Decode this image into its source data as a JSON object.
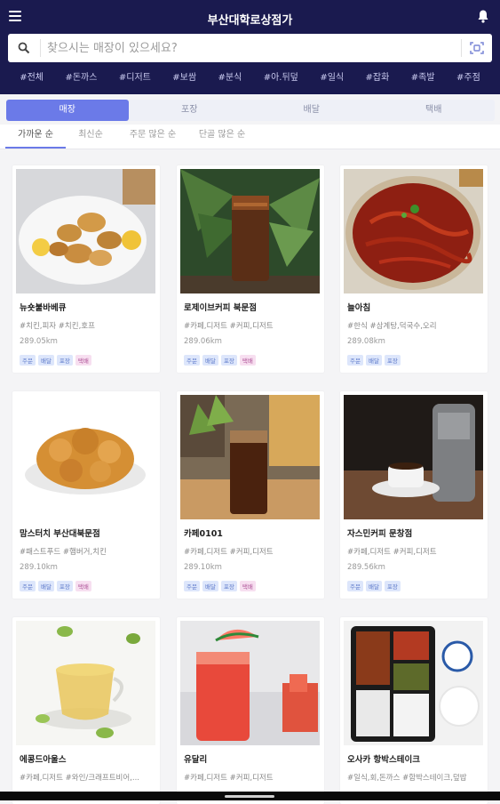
{
  "header": {
    "title": "부산대학로상점가",
    "menu_icon": "hamburger-menu-icon",
    "bell_icon": "bell-icon"
  },
  "search": {
    "placeholder": "찾으시는 매장이 있으세요?",
    "value": "",
    "icons": [
      "search-icon",
      "scan-icon"
    ]
  },
  "categories": [
    "#전체",
    "#돈까스",
    "#디저트",
    "#보쌈",
    "#분식",
    "#아.뒤덮",
    "#일식",
    "#잡화",
    "#족발",
    "#주점"
  ],
  "tabs": [
    {
      "label": "매장",
      "active": true
    },
    {
      "label": "포장",
      "active": false
    },
    {
      "label": "배달",
      "active": false
    },
    {
      "label": "택배",
      "active": false
    }
  ],
  "sort_options": [
    {
      "label": "가까운 순",
      "active": true
    },
    {
      "label": "최신순",
      "active": false
    },
    {
      "label": "주문 많은 순",
      "active": false
    },
    {
      "label": "단골 많은 순",
      "active": false
    }
  ],
  "stores": [
    {
      "name": "뉴숏불바베큐",
      "tags": "#치킨,피자 #치킨,호프",
      "distance": "289.05km",
      "badges": [
        "주문",
        "배달",
        "포장",
        "택배"
      ]
    },
    {
      "name": "로제이브커피 북문점",
      "tags": "#카페,디저트 #커피,디저트",
      "distance": "289.06km",
      "badges": [
        "주문",
        "배달",
        "포장",
        "택배"
      ]
    },
    {
      "name": "늘아침",
      "tags": "#한식 #삼계탕,덕국수,오리",
      "distance": "289.08km",
      "badges": [
        "주문",
        "배달",
        "포장"
      ]
    },
    {
      "name": "맘스터치 부산대북문점",
      "tags": "#패스트푸드 #햄버거,치킨",
      "distance": "289.10km",
      "badges": [
        "주문",
        "배달",
        "포장",
        "택배"
      ]
    },
    {
      "name": "카페0101",
      "tags": "#카페,디저트 #커피,디저트",
      "distance": "289.10km",
      "badges": [
        "주문",
        "배달",
        "포장",
        "택배"
      ]
    },
    {
      "name": "자스민커피 문창점",
      "tags": "#카페,디저트 #커피,디저트",
      "distance": "289.56km",
      "badges": [
        "주문",
        "배달",
        "포장"
      ]
    },
    {
      "name": "에콩드아울스",
      "tags": "#카페,디저트 #와인/크래프트비어,...",
      "distance": "",
      "badges": []
    },
    {
      "name": "유달리",
      "tags": "#카페,디저트 #커피,디저트",
      "distance": "",
      "badges": []
    },
    {
      "name": "오사카 항박스테이크",
      "tags": "#일식,회,돈까스 #함박스테이크,덮밥",
      "distance": "",
      "badges": []
    }
  ],
  "colors": {
    "header_bg": "#1a1a4f",
    "accent": "#6b7ae8",
    "badge_blue": "#5c78c9",
    "badge_pink": "#b0579a"
  }
}
